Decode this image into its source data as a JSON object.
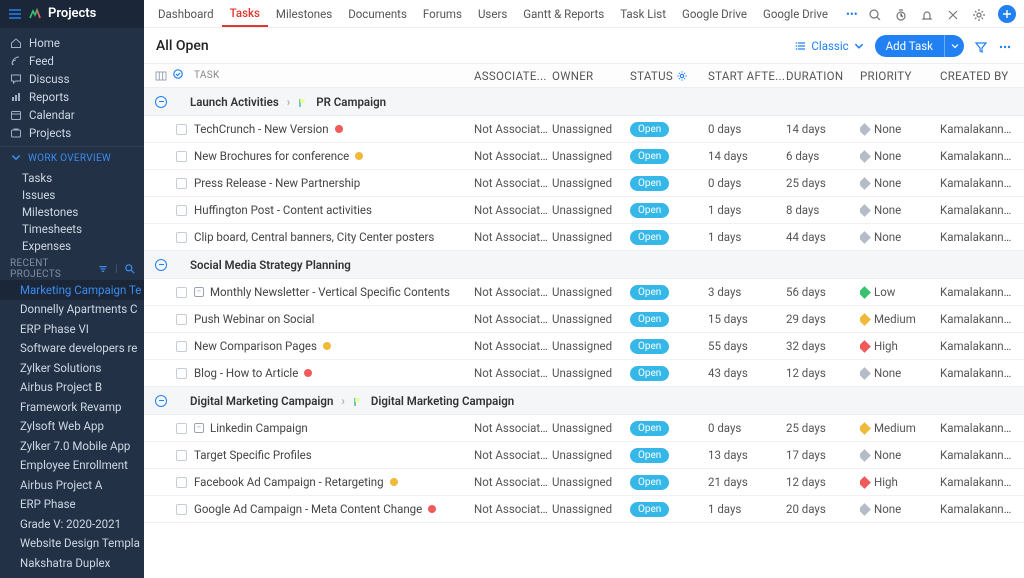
{
  "brand": {
    "title": "Projects"
  },
  "sidebar": {
    "primary": [
      {
        "icon": "home",
        "label": "Home"
      },
      {
        "icon": "feed",
        "label": "Feed"
      },
      {
        "icon": "discuss",
        "label": "Discuss"
      },
      {
        "icon": "reports",
        "label": "Reports"
      },
      {
        "icon": "calendar",
        "label": "Calendar"
      },
      {
        "icon": "projects",
        "label": "Projects"
      }
    ],
    "work_overview": {
      "label": "WORK OVERVIEW",
      "items": [
        "Tasks",
        "Issues",
        "Milestones",
        "Timesheets",
        "Expenses"
      ]
    },
    "recent_projects": {
      "label": "RECENT PROJECTS",
      "items": [
        "Marketing Campaign Te",
        "Donnelly Apartments C",
        "ERP Phase VI",
        "Software developers re",
        "Zylker Solutions",
        "Airbus Project B",
        "Framework Revamp",
        "Zylsoft Web App",
        "Zylker 7.0 Mobile App",
        "Employee Enrollment",
        "Airbus Project A",
        "ERP Phase",
        "Grade V: 2020-2021",
        "Website Design Templa",
        "Nakshatra Duplex"
      ],
      "active_index": 0
    }
  },
  "topnav": {
    "tabs": [
      "Dashboard",
      "Tasks",
      "Milestones",
      "Documents",
      "Forums",
      "Users",
      "Gantt & Reports",
      "Task List",
      "Google Drive",
      "Google Drive"
    ],
    "active_index": 1
  },
  "toolbar": {
    "title": "All Open",
    "classic_label": "Classic",
    "addtask_label": "Add Task"
  },
  "columns": {
    "task": "TASK",
    "associate": "ASSOCIATE...",
    "owner": "OWNER",
    "status": "STATUS",
    "start": "START AFTE...",
    "duration": "DURATION",
    "priority": "PRIORITY",
    "created": "CREATED BY"
  },
  "values": {
    "not_associated": "Not Associated",
    "unassigned": "Unassigned",
    "open": "Open",
    "none": "None",
    "low": "Low",
    "medium": "Medium",
    "high": "High",
    "creator": "Kamalakannan B"
  },
  "groups": [
    {
      "crumb": [
        "Launch Activities",
        "PR Campaign"
      ],
      "has_flag": true,
      "tasks": [
        {
          "title": "TechCrunch - New Version",
          "mark": "red",
          "start": "0 days",
          "duration": "14 days",
          "priority": "none"
        },
        {
          "title": "New Brochures for conference",
          "mark": "amber",
          "start": "14 days",
          "duration": "6 days",
          "priority": "none"
        },
        {
          "title": "Press Release - New Partnership",
          "start": "0 days",
          "duration": "25 days",
          "priority": "none"
        },
        {
          "title": "Huffington Post - Content activities",
          "start": "1 days",
          "duration": "8 days",
          "priority": "none"
        },
        {
          "title": "Clip board, Central banners, City Center posters",
          "start": "1 days",
          "duration": "44 days",
          "priority": "none"
        }
      ]
    },
    {
      "crumb": [
        "Social Media Strategy Planning"
      ],
      "has_flag": false,
      "tasks": [
        {
          "title": "Monthly Newsletter - Vertical Specific Contents",
          "indent": 1,
          "tree": true,
          "start": "3 days",
          "duration": "56 days",
          "priority": "low"
        },
        {
          "title": "Push Webinar on Social",
          "indent": 2,
          "start": "15 days",
          "duration": "29 days",
          "priority": "medium"
        },
        {
          "title": "New Comparison Pages",
          "mark": "amber",
          "start": "55 days",
          "duration": "32 days",
          "priority": "high"
        },
        {
          "title": "Blog - How to Article",
          "mark": "red",
          "start": "43 days",
          "duration": "12 days",
          "priority": "none"
        }
      ]
    },
    {
      "crumb": [
        "Digital Marketing Campaign",
        "Digital Marketing Campaign"
      ],
      "has_flag": true,
      "tasks": [
        {
          "title": "Linkedin Campaign",
          "indent": 1,
          "tree": true,
          "start": "0 days",
          "duration": "25 days",
          "priority": "medium"
        },
        {
          "title": "Target Specific Profiles",
          "indent": 2,
          "start": "13 days",
          "duration": "17 days",
          "priority": "none"
        },
        {
          "title": "Facebook Ad Campaign - Retargeting",
          "mark": "amber",
          "start": "21 days",
          "duration": "12 days",
          "priority": "high"
        },
        {
          "title": "Google Ad Campaign - Meta Content Change",
          "mark": "red",
          "start": "1 days",
          "duration": "20 days",
          "priority": "none"
        }
      ]
    }
  ]
}
